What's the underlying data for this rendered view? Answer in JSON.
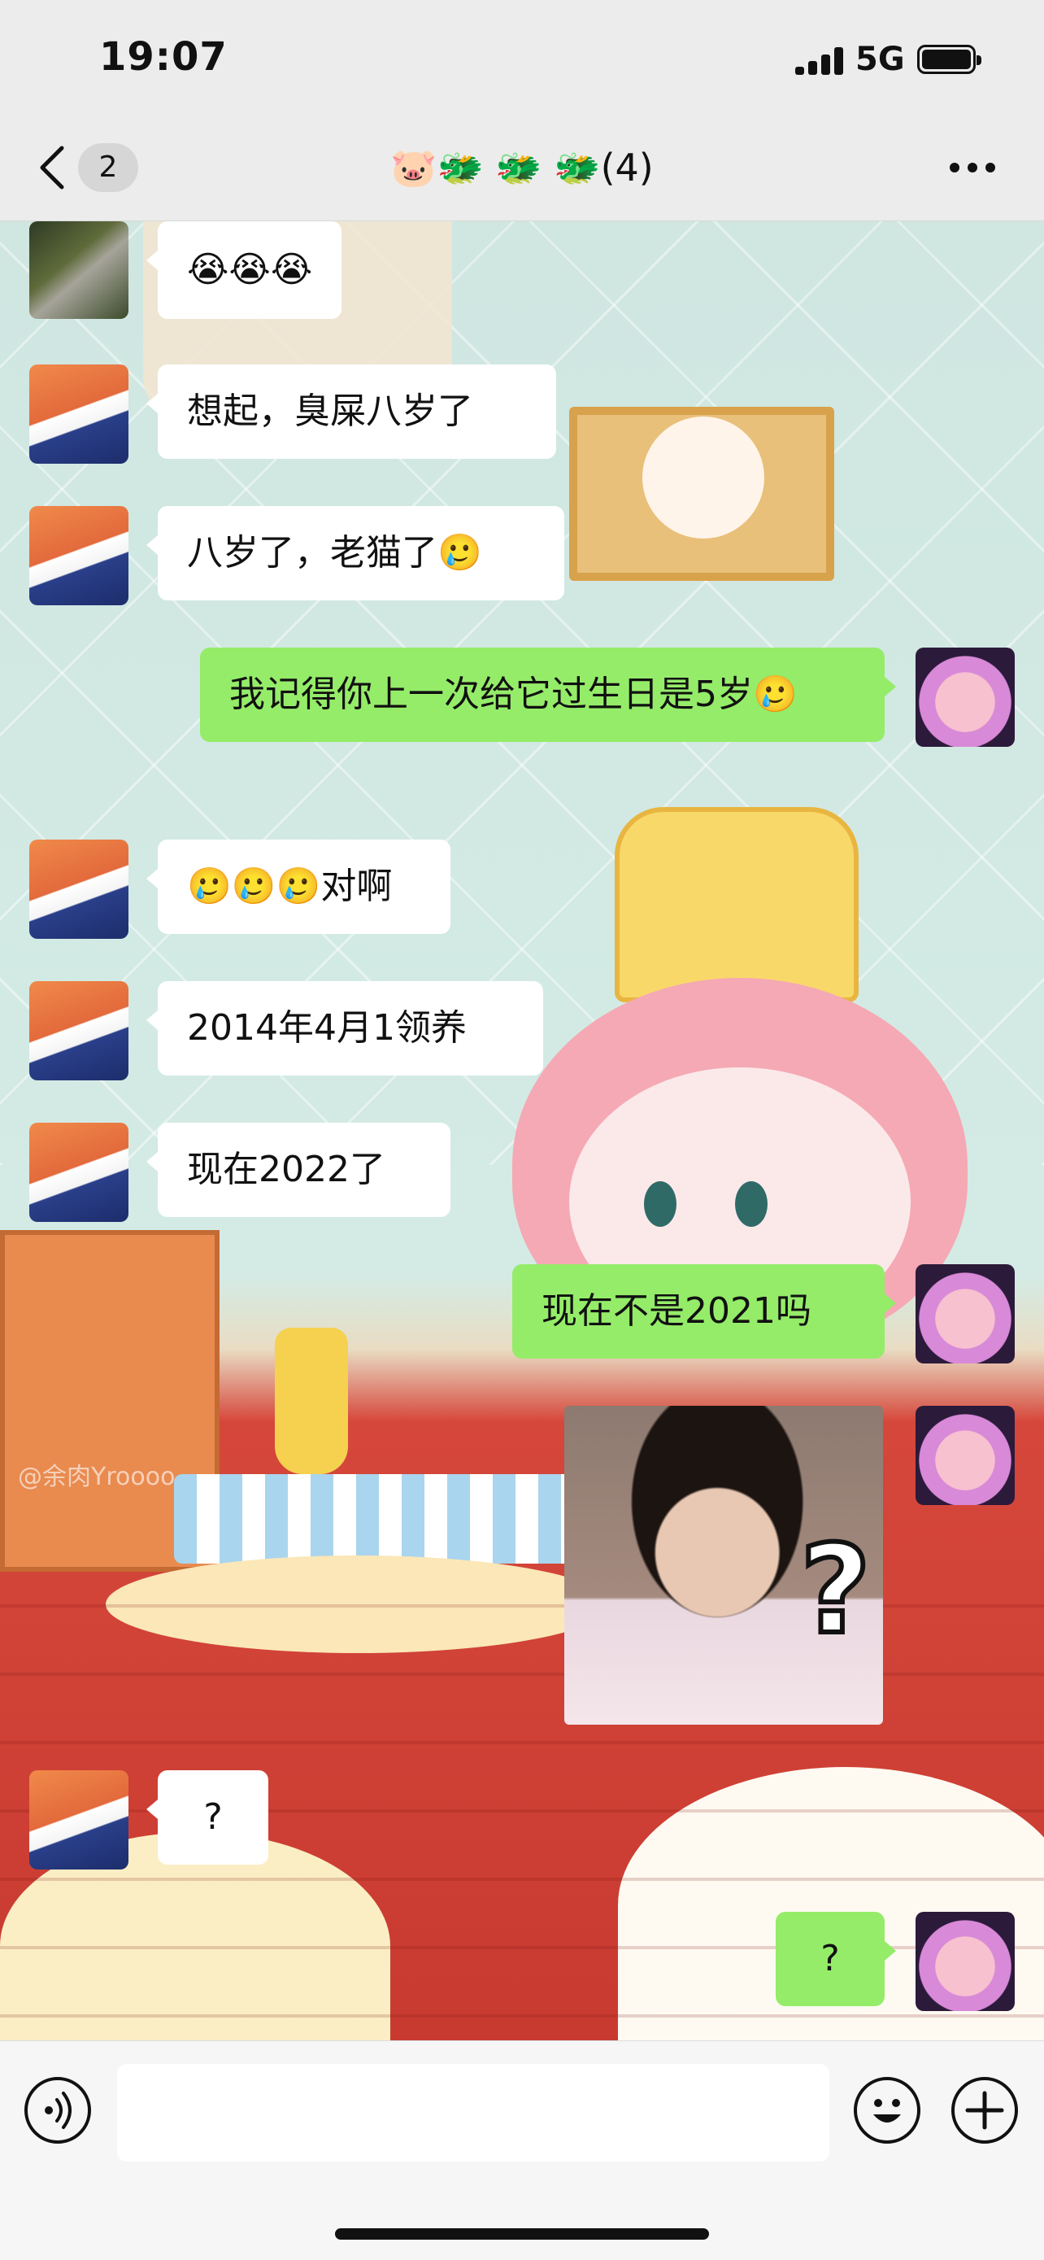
{
  "status": {
    "time": "19:07",
    "network": "5G"
  },
  "nav": {
    "back_count": "2",
    "title": "🐷🐲 🐲 🐲(4)"
  },
  "messages": [
    {
      "side": "in",
      "text": "😭😭😭"
    },
    {
      "side": "in",
      "text": "想起，臭屎八岁了"
    },
    {
      "side": "in",
      "text": "八岁了，老猫了🥲"
    },
    {
      "side": "out",
      "text": "我记得你上一次给它过生日是5岁🥲"
    },
    {
      "side": "in",
      "text": "🥲🥲🥲对啊"
    },
    {
      "side": "in",
      "text": "2014年4月1领养"
    },
    {
      "side": "in",
      "text": "现在2022了"
    },
    {
      "side": "out",
      "text": "现在不是2021吗"
    },
    {
      "side": "out",
      "sticker": "surprised-woman-question-sticker",
      "text": "?"
    },
    {
      "side": "in",
      "text": "?"
    },
    {
      "side": "out",
      "text": "?"
    }
  ],
  "wallpaper": {
    "watermark": "@余肉Yroooo"
  },
  "colors": {
    "bubble_out": "#95ec69",
    "bubble_in": "#ffffff",
    "nav_bg": "#ececec"
  },
  "icons": {
    "back": "chevron-left-icon",
    "more": "more-dots-icon",
    "voice": "voice-icon",
    "emoji": "emoji-icon",
    "add": "plus-icon"
  }
}
